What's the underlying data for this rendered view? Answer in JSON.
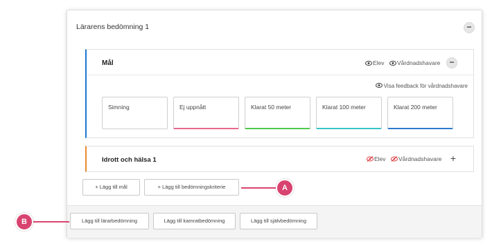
{
  "card": {
    "title": "Lärarens bedömning 1",
    "collapse_symbol": "−"
  },
  "mal_panel": {
    "title": "Mål",
    "visibility": [
      "Elev",
      "Vårdnadshavare"
    ],
    "collapse_symbol": "−",
    "feedback_link": "Visa feedback för vårdnadshavare",
    "criteria": [
      {
        "label": "Simning",
        "accent": "#ffffff"
      },
      {
        "label": "Ej uppnått",
        "accent": "#e8668d"
      },
      {
        "label": "Klarat 50 meter",
        "accent": "#4ec94a"
      },
      {
        "label": "Klarat 100 meter",
        "accent": "#38c4c8"
      },
      {
        "label": "Klarat 200 meter",
        "accent": "#2d7ad2"
      }
    ],
    "accent_color": "#1c77d1"
  },
  "idrott_panel": {
    "title": "Idrott och hälsa 1",
    "visibility": [
      "Elev",
      "Vårdnadshavare"
    ],
    "expand_symbol": "+",
    "hidden_color": "#d9363e",
    "accent_color": "#e8892e"
  },
  "add_buttons": {
    "add_goal": "+ Lägg till mål",
    "add_criteria": "+ Lägg till bedömningskriterie"
  },
  "footer_buttons": {
    "teacher": "Lägg till lärarbedömning",
    "peer": "Lägg till kamratbedömning",
    "self": "Lägg till självbedömning"
  },
  "markers": {
    "a": "A",
    "b": "B",
    "color": "#d9436f"
  }
}
